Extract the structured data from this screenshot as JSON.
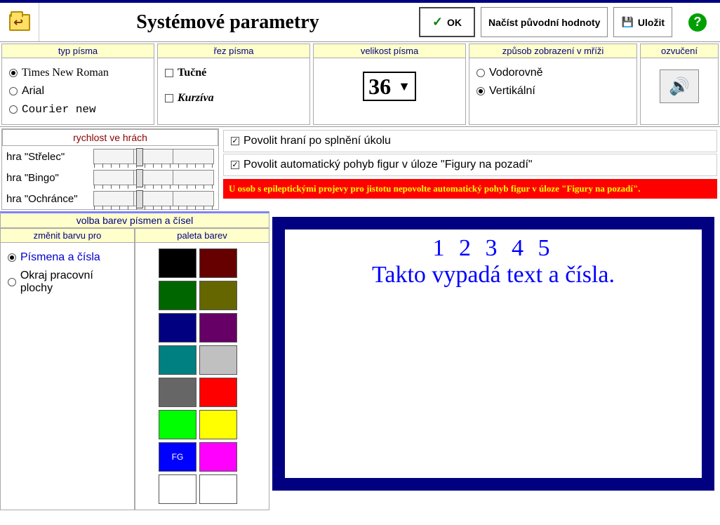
{
  "header": {
    "title": "Systémové parametry",
    "ok_label": "OK",
    "reload_label": "Načíst původní hodnoty",
    "save_label": "Uložit"
  },
  "font_type": {
    "header": "typ písma",
    "options": [
      "Times New Roman",
      "Arial",
      "Courier new"
    ],
    "selected": 0
  },
  "font_style": {
    "header": "řez písma",
    "bold_label": "Tučné",
    "bold_checked": false,
    "italic_label": "Kurzíva",
    "italic_checked": false
  },
  "font_size": {
    "header": "velikost písma",
    "value": "36"
  },
  "grid_mode": {
    "header": "způsob zobrazení v mříži",
    "options": [
      "Vodorovně",
      "Vertikální"
    ],
    "selected": 1
  },
  "sound": {
    "header": "ozvučení"
  },
  "speed": {
    "header": "rychlost ve hrách",
    "rows": [
      {
        "label": "hra \"Střelec\"",
        "pos": 35
      },
      {
        "label": "hra \"Bingo\"",
        "pos": 35
      },
      {
        "label": "hra \"Ochránce\"",
        "pos": 35
      }
    ]
  },
  "checks": {
    "allow_play_label": "Povolit hraní po splnění úkolu",
    "allow_play_checked": true,
    "allow_auto_label": "Povolit automatický pohyb figur v úloze \"Figury na pozadí\"",
    "allow_auto_checked": true,
    "warning": "U osob s epileptickými projevy pro jistotu nepovolte automatický pohyb figur v úloze \"Figury na pozadí\"."
  },
  "colors": {
    "header": "volba barev písmen a čísel",
    "change_for_header": "změnit barvu pro",
    "change_options": [
      "Písmena a čísla",
      "Okraj pracovní plochy"
    ],
    "change_selected": 0,
    "palette_header": "paleta barev",
    "palette": [
      "#000000",
      "#660000",
      "#006600",
      "#666600",
      "#000080",
      "#660066",
      "#008080",
      "#c0c0c0",
      "#666666",
      "#ff0000",
      "#00ff00",
      "#ffff00",
      "#0000ff",
      "#ff00ff",
      "#ffffff",
      "#ffffff"
    ],
    "fg_index": 12,
    "fg_label": "FG"
  },
  "preview": {
    "numbers": "1 2 3 4 5",
    "text": "Takto vypadá text a čísla."
  }
}
